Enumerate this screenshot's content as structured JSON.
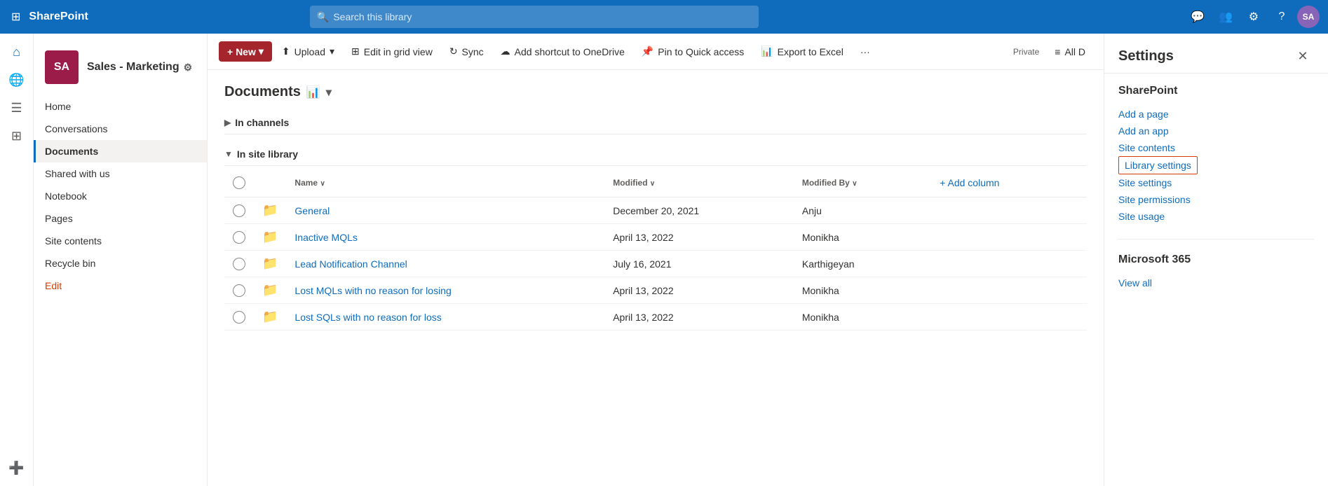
{
  "topNav": {
    "gridIcon": "⊞",
    "logoText": "SharePoint",
    "searchPlaceholder": "Search this library",
    "icons": [
      {
        "name": "chat-icon",
        "symbol": "💬"
      },
      {
        "name": "contacts-icon",
        "symbol": "👥"
      },
      {
        "name": "settings-icon",
        "symbol": "⚙"
      },
      {
        "name": "help-icon",
        "symbol": "?"
      }
    ],
    "avatarText": "SA"
  },
  "iconRail": {
    "icons": [
      {
        "name": "home-rail-icon",
        "symbol": "⌂"
      },
      {
        "name": "globe-rail-icon",
        "symbol": "🌐"
      },
      {
        "name": "feed-rail-icon",
        "symbol": "≡"
      },
      {
        "name": "apps-rail-icon",
        "symbol": "⊞"
      },
      {
        "name": "add-rail-icon",
        "symbol": "+"
      }
    ]
  },
  "sidebar": {
    "siteAvatarText": "SA",
    "siteTitle": "Sales - Marketing",
    "gearLabel": "⚙",
    "privateLabel": "Private",
    "navItems": [
      {
        "label": "Home",
        "active": false
      },
      {
        "label": "Conversations",
        "active": false
      },
      {
        "label": "Documents",
        "active": true
      },
      {
        "label": "Shared with us",
        "active": false
      },
      {
        "label": "Notebook",
        "active": false
      },
      {
        "label": "Pages",
        "active": false
      },
      {
        "label": "Site contents",
        "active": false
      },
      {
        "label": "Recycle bin",
        "active": false
      }
    ],
    "editLabel": "Edit"
  },
  "toolbar": {
    "newLabel": "+ New",
    "newChevron": "▾",
    "uploadLabel": "↑ Upload",
    "uploadChevron": "▾",
    "editGridLabel": "Edit in grid view",
    "syncLabel": "↻ Sync",
    "addShortcutLabel": "Add shortcut to OneDrive",
    "pinLabel": "Pin to Quick access",
    "exportLabel": "Export to Excel",
    "moreLabel": "···",
    "allDocumentsLabel": "All D",
    "allDocumentsIcon": "≡"
  },
  "content": {
    "sectionTitle": "Documents",
    "sectionIconSymbol": "📊",
    "groupInChannels": "In channels",
    "groupInSiteLibrary": "In site library",
    "columns": [
      {
        "label": "Name",
        "sortable": true
      },
      {
        "label": "Modified",
        "sortable": true
      },
      {
        "label": "Modified By",
        "sortable": true
      },
      {
        "label": "+ Add column",
        "sortable": false
      }
    ],
    "files": [
      {
        "name": "General",
        "modified": "December 20, 2021",
        "modifiedBy": "Anju",
        "isFolder": true
      },
      {
        "name": "Inactive MQLs",
        "modified": "April 13, 2022",
        "modifiedBy": "Monikha",
        "isFolder": true
      },
      {
        "name": "Lead Notification Channel",
        "modified": "July 16, 2021",
        "modifiedBy": "Karthigeyan",
        "isFolder": true
      },
      {
        "name": "Lost MQLs with no reason for losing",
        "modified": "April 13, 2022",
        "modifiedBy": "Monikha",
        "isFolder": true
      },
      {
        "name": "Lost SQLs with no reason for loss",
        "modified": "April 13, 2022",
        "modifiedBy": "Monikha",
        "isFolder": true
      }
    ]
  },
  "settings": {
    "title": "Settings",
    "closeSymbol": "✕",
    "sharePointSection": {
      "title": "SharePoint",
      "links": [
        {
          "label": "Add a page",
          "highlighted": false
        },
        {
          "label": "Add an app",
          "highlighted": false
        },
        {
          "label": "Site contents",
          "highlighted": false
        },
        {
          "label": "Library settings",
          "highlighted": true
        },
        {
          "label": "Site settings",
          "highlighted": false
        },
        {
          "label": "Site permissions",
          "highlighted": false
        },
        {
          "label": "Site usage",
          "highlighted": false
        }
      ]
    },
    "microsoft365Section": {
      "title": "Microsoft 365",
      "links": [
        {
          "label": "View all",
          "highlighted": false
        }
      ]
    }
  }
}
